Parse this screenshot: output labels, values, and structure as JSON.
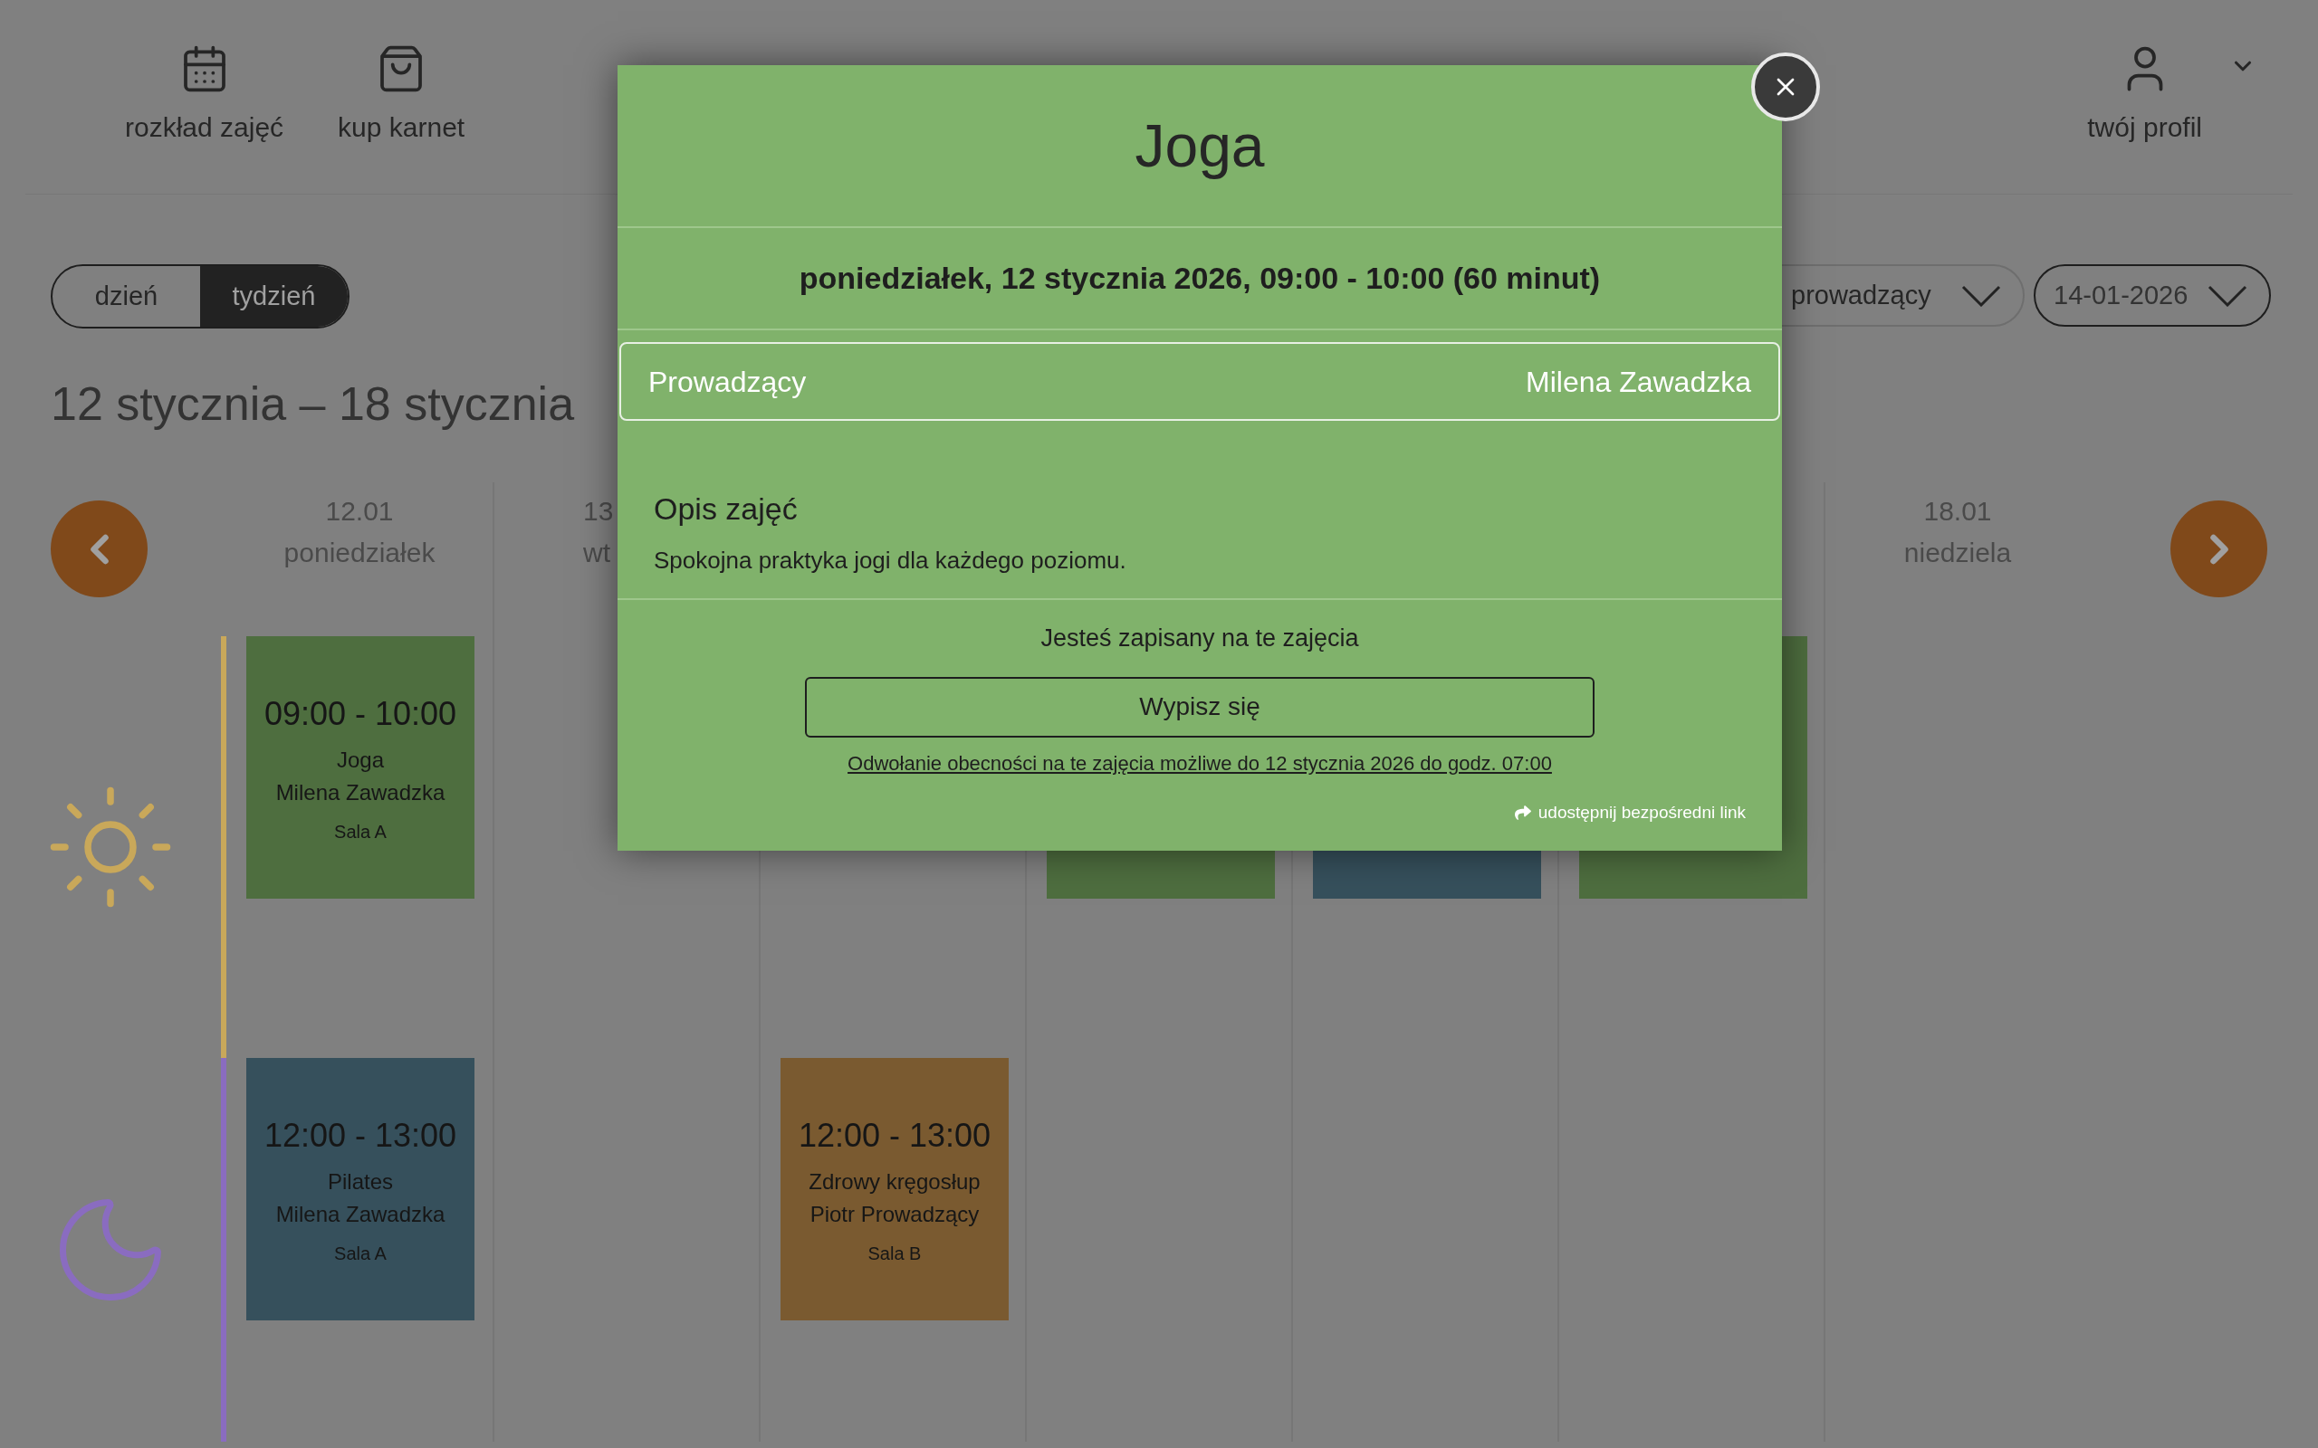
{
  "nav": [
    {
      "kind": "calendar",
      "label": "rozkład zajęć"
    },
    {
      "kind": "bag",
      "label": "kup karnet"
    }
  ],
  "profile": {
    "label": "twój profil"
  },
  "view_toggle": [
    {
      "label": "dzień",
      "selected": false
    },
    {
      "label": "tydzień",
      "selected": true
    }
  ],
  "week_title": "12 stycznia – 18 stycznia",
  "teacher_filter": {
    "value": "prowadzący"
  },
  "date_filter": {
    "value": "14-01-2026"
  },
  "days": [
    {
      "date": "12.01",
      "day": "poniedziałek",
      "clipped": false,
      "morning": {
        "time": "09:00 - 10:00",
        "name": "Joga",
        "teacher": "Milena Zawadzka",
        "room": "Sala A",
        "color": "#4e6e3f"
      },
      "evening": {
        "time": "12:00 - 13:00",
        "name": "Pilates",
        "teacher": "Milena Zawadzka",
        "room": "Sala A",
        "color": "#36505c"
      }
    },
    {
      "date": "13",
      "day": "wt",
      "clipped": true
    },
    {
      "evening": {
        "time": "12:00 - 13:00",
        "name": "Zdrowy kręgosłup",
        "teacher": "Piotr Prowadzący",
        "room": "Sala B",
        "color": "#7a5a30"
      }
    },
    {
      "morning": {
        "color": "#4e6e3f"
      }
    },
    {
      "morning": {
        "color": "#36505c"
      }
    },
    {
      "morning": {
        "color": "#4e6e3f"
      }
    },
    {
      "date": "18.01",
      "day": "niedziela",
      "clipped": false
    }
  ],
  "modal": {
    "title": "Joga",
    "datetime": "poniedziałek, 12 stycznia 2026, 09:00 - 10:00 (60 minut)",
    "details": [
      {
        "label": "Prowadzący",
        "value": "Milena Zawadzka"
      }
    ],
    "description_heading": "Opis zajęć",
    "description": "Spokojna praktyka jogi dla każdego poziomu.",
    "status": "Jesteś zapisany na te zajęcia",
    "button": "Wypisz się",
    "cancel_note": "Odwołanie obecności na te zajęcia możliwe do 12 stycznia 2026 do godz. 07:00",
    "share_link": "udostępnij bezpośredni link"
  }
}
